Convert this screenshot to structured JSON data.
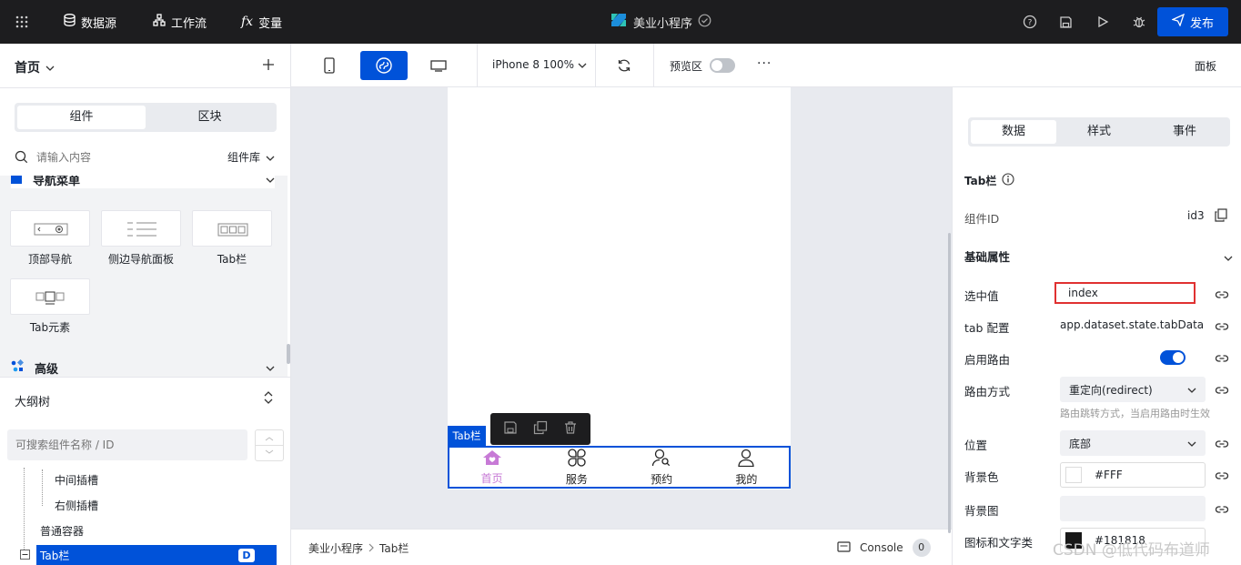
{
  "topbar": {
    "datasource": "数据源",
    "workflow": "工作流",
    "variables": "变量",
    "app_title": "美业小程序",
    "publish": "发布"
  },
  "left": {
    "page_select": "首页",
    "tabs": [
      "组件",
      "区块"
    ],
    "search_placeholder": "请输入内容",
    "library": "组件库",
    "group_nav": "导航菜单",
    "components": [
      "顶部导航",
      "侧边导航面板",
      "Tab栏",
      "Tab元素"
    ],
    "group_advanced": "高级",
    "outline_title": "大纲树",
    "outline_search_placeholder": "可搜索组件名称 / ID",
    "tree": [
      "中间插槽",
      "右侧插槽",
      "普通容器",
      "Tab栏"
    ],
    "tree_badge": "D"
  },
  "toolbar": {
    "device": "iPhone 8 100%",
    "preview": "预览区",
    "panel": "面板"
  },
  "canvas": {
    "selected_tag": "Tab栏",
    "tabs": [
      {
        "label": "首页",
        "icon": "home-icon",
        "active": true
      },
      {
        "label": "服务",
        "icon": "grid-icon",
        "active": false
      },
      {
        "label": "预约",
        "icon": "user-search-icon",
        "active": false
      },
      {
        "label": "我的",
        "icon": "user-icon",
        "active": false
      }
    ],
    "accent": "#c77ad6"
  },
  "bottombar": {
    "breadcrumb": [
      "美业小程序",
      "Tab栏"
    ],
    "console": "Console",
    "console_count": "0"
  },
  "right": {
    "tabs": [
      "数据",
      "样式",
      "事件"
    ],
    "component_name": "Tab栏",
    "component_id_label": "组件ID",
    "component_id": "id3",
    "section": "基础属性",
    "props": {
      "selected_label": "选中值",
      "selected_value": "index",
      "tab_config_label": "tab 配置",
      "tab_config_value": "app.dataset.state.tabData",
      "routing_label": "启用路由",
      "route_mode_label": "路由方式",
      "route_mode_value": "重定向(redirect)",
      "route_hint": "路由跳转方式，当启用路由时生效",
      "position_label": "位置",
      "position_value": "底部",
      "bg_color_label": "背景色",
      "bg_color_value": "#FFF",
      "bg_image_label": "背景图",
      "icon_text_label": "图标和文字类",
      "icon_text_value": "#181818"
    }
  },
  "watermark": "CSDN @低代码布道师",
  "colors": {
    "primary": "#0052d9",
    "highlight_box": "#e03131"
  }
}
